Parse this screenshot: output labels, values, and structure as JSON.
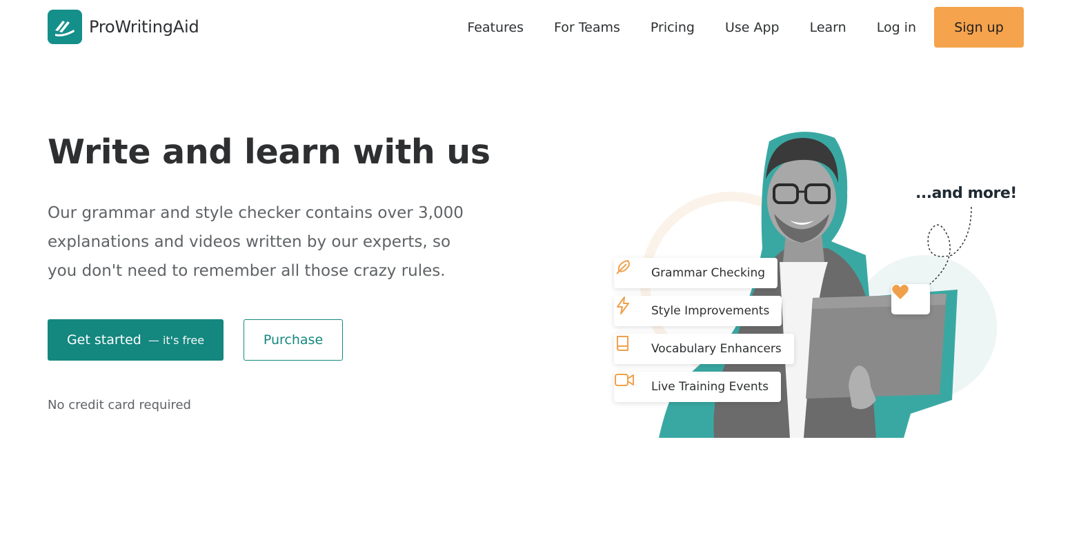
{
  "brand": {
    "name": "ProWritingAid"
  },
  "nav": {
    "items": [
      "Features",
      "For Teams",
      "Pricing",
      "Use App",
      "Learn"
    ],
    "login": "Log in",
    "signup": "Sign up"
  },
  "hero": {
    "title": "Write and learn with us",
    "description": "Our grammar and style checker contains over 3,000 explanations and videos written by our experts, so you don't need to remember all those crazy rules.",
    "cta_primary": "Get started",
    "cta_primary_sub": "— it's free",
    "cta_secondary": "Purchase",
    "note": "No credit card required"
  },
  "illustration": {
    "tagline": "...and more!",
    "features": [
      {
        "label": "Grammar Checking",
        "icon": "feather-icon"
      },
      {
        "label": "Style Improvements",
        "icon": "lightning-icon"
      },
      {
        "label": "Vocabulary Enhancers",
        "icon": "book-icon"
      },
      {
        "label": "Live Training Events",
        "icon": "video-camera-icon"
      }
    ],
    "heart_icon": "heart-icon"
  },
  "colors": {
    "brand_teal": "#148f8a",
    "button_teal": "#14877f",
    "signup_orange": "#f5a34c",
    "icon_orange": "#f0a04b",
    "text_dark": "#2d2f31",
    "text_muted": "#5f6366"
  }
}
